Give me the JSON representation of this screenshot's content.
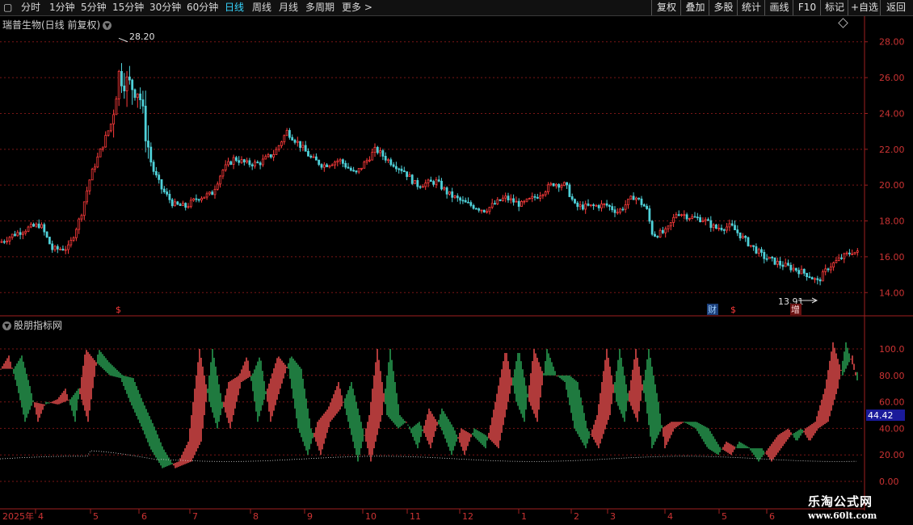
{
  "toolbar": {
    "periods": [
      "分时",
      "1分钟",
      "5分钟",
      "15分钟",
      "30分钟",
      "60分钟",
      "日线",
      "周线",
      "月线",
      "多周期",
      "更多 >"
    ],
    "active_period": "日线",
    "right_buttons": [
      "复权",
      "叠加",
      "多股",
      "统计",
      "画线",
      "F10",
      "标记",
      "+自选",
      "返回"
    ]
  },
  "chart": {
    "title": "瑞普生物(日线 前复权)",
    "high_label": "28.20",
    "low_label": "13.91",
    "markers": [
      {
        "text": "$",
        "color": "#ff3b3b"
      },
      {
        "text": "财",
        "color": "#5fa8ff"
      },
      {
        "text": "$",
        "color": "#ff3b3b"
      },
      {
        "text": "增",
        "color": "#ff3b3b"
      }
    ]
  },
  "indicator": {
    "title": "股朋指标网",
    "current_value": "44.42",
    "y_ticks": [
      "100.0",
      "80.00",
      "60.00",
      "40.00",
      "20.00",
      "0.00"
    ]
  },
  "watermark": {
    "name": "乐淘公式网",
    "url": "www.60lt.com"
  },
  "chart_data": {
    "type": "candlestick",
    "y_ticks": [
      "28.00",
      "26.00",
      "24.00",
      "22.00",
      "20.00",
      "18.00",
      "16.00",
      "14.00"
    ],
    "ylim": [
      13.2,
      28.8
    ],
    "x_labels": [
      "2025年",
      "4",
      "5",
      "6",
      "7",
      "8",
      "9",
      "10",
      "11",
      "12",
      "1",
      "2",
      "3",
      "4",
      "5",
      "6"
    ],
    "colors": {
      "up": "#ff3b3b",
      "down": "#4fd1d9",
      "fill_up": "#b03a3a",
      "fill_down": "#1f7a3f"
    }
  }
}
